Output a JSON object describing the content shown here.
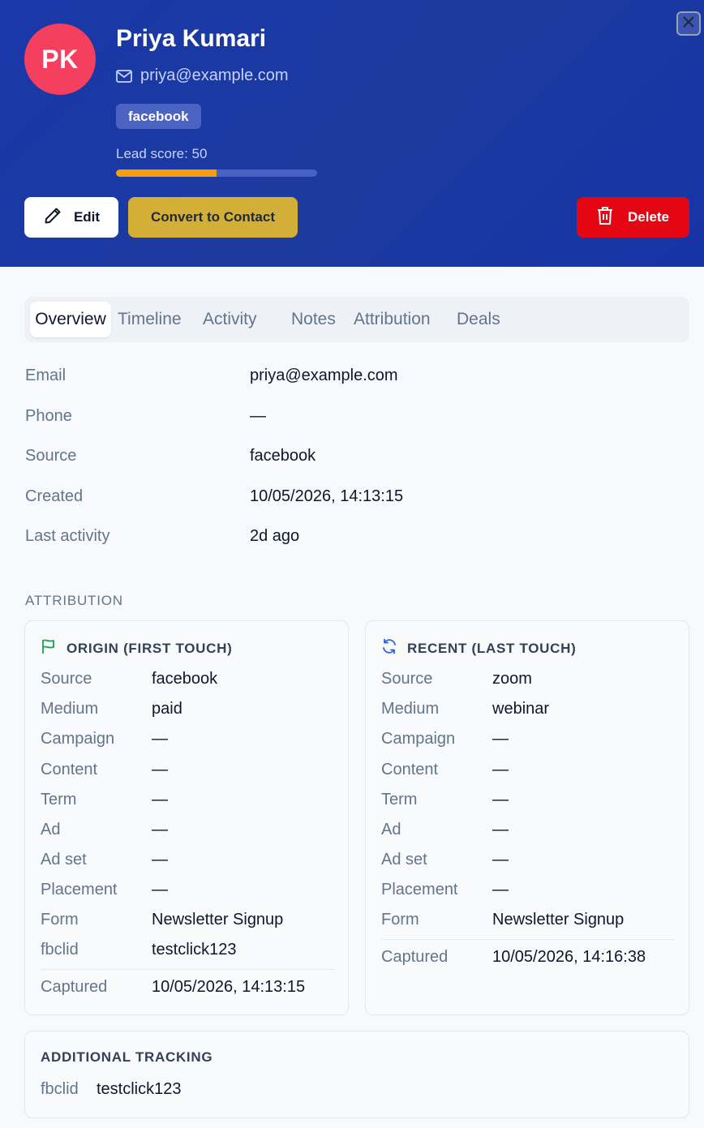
{
  "header": {
    "initials": "PK",
    "name": "Priya Kumari",
    "email": "priya@example.com",
    "source_tag": "facebook",
    "lead_score_label": "Lead score: 50",
    "lead_score_value": 50,
    "lead_score_max": 100,
    "icons": {
      "email": "mail-icon",
      "close": "close-icon",
      "edit": "pencil-icon",
      "delete": "trash-icon"
    },
    "colors": {
      "header_bg": "#1c3a9f",
      "avatar": "#f43f5e",
      "score_fill": "#f59e0b",
      "convert": "#d4af37",
      "delete": "#e40613"
    }
  },
  "actions": {
    "edit_label": "Edit",
    "convert_label": "Convert to Contact",
    "delete_label": "Delete"
  },
  "tabs": [
    {
      "label": "Overview",
      "active": true
    },
    {
      "label": "Timeline"
    },
    {
      "label": "Activity"
    },
    {
      "label": "Notes"
    },
    {
      "label": "Attribution"
    },
    {
      "label": "Deals"
    }
  ],
  "overview": [
    {
      "label": "Email",
      "value": "priya@example.com"
    },
    {
      "label": "Phone",
      "value": "—"
    },
    {
      "label": "Source",
      "value": "facebook"
    },
    {
      "label": "Created",
      "value": "10/05/2026, 14:13:15"
    },
    {
      "label": "Last activity",
      "value": "2d ago"
    }
  ],
  "attribution": {
    "title": "ATTRIBUTION",
    "first_touch": {
      "title": "ORIGIN (FIRST TOUCH)",
      "icon": "flag-icon",
      "rows": [
        {
          "label": "Source",
          "value": "facebook"
        },
        {
          "label": "Medium",
          "value": "paid"
        },
        {
          "label": "Campaign",
          "value": "—"
        },
        {
          "label": "Content",
          "value": "—"
        },
        {
          "label": "Term",
          "value": "—"
        },
        {
          "label": "Ad",
          "value": "—"
        },
        {
          "label": "Ad set",
          "value": "—"
        },
        {
          "label": "Placement",
          "value": "—"
        },
        {
          "label": "Form",
          "value": "Newsletter Signup"
        },
        {
          "label": "fbclid",
          "value": "testclick123"
        }
      ],
      "captured_label": "Captured",
      "captured_value": "10/05/2026, 14:13:15"
    },
    "last_touch": {
      "title": "RECENT (LAST TOUCH)",
      "icon": "refresh-icon",
      "rows": [
        {
          "label": "Source",
          "value": "zoom"
        },
        {
          "label": "Medium",
          "value": "webinar"
        },
        {
          "label": "Campaign",
          "value": "—"
        },
        {
          "label": "Content",
          "value": "—"
        },
        {
          "label": "Term",
          "value": "—"
        },
        {
          "label": "Ad",
          "value": "—"
        },
        {
          "label": "Ad set",
          "value": "—"
        },
        {
          "label": "Placement",
          "value": "—"
        },
        {
          "label": "Form",
          "value": "Newsletter Signup"
        }
      ],
      "captured_label": "Captured",
      "captured_value": "10/05/2026, 14:16:38"
    }
  },
  "additional_tracking": {
    "title": "ADDITIONAL TRACKING",
    "label": "fbclid",
    "value": "testclick123"
  }
}
